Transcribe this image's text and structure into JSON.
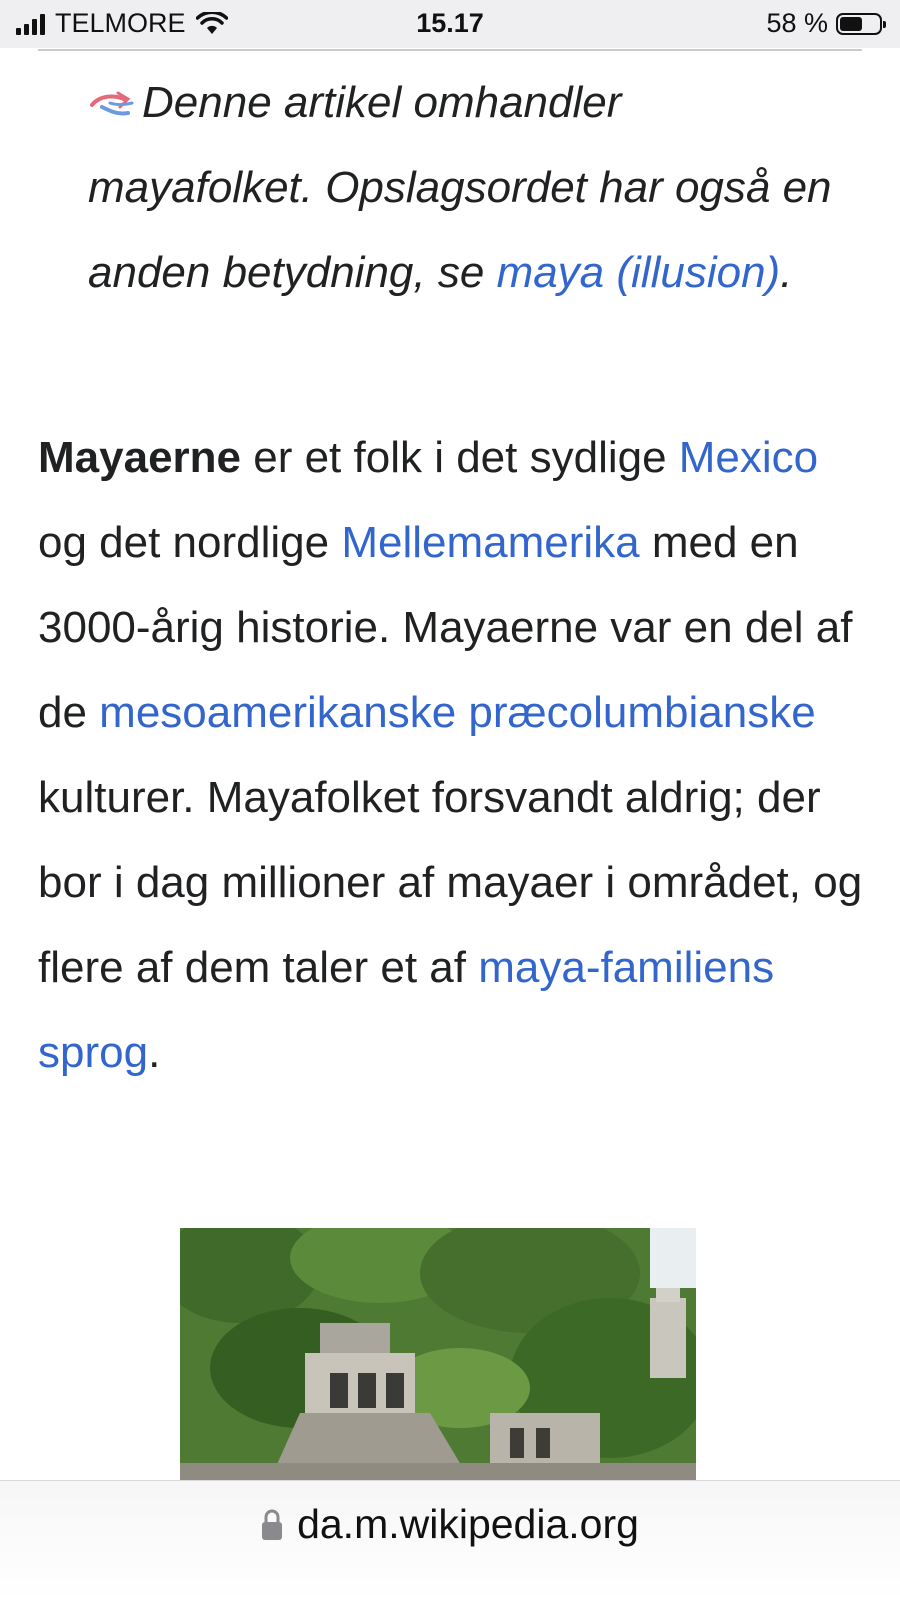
{
  "status_bar": {
    "carrier": "TELMORE",
    "time": "15.17",
    "battery_percent": "58 %",
    "battery_level": 0.58
  },
  "hatnote": {
    "text": "Denne artikel omhandler mayafolket. Opslagsordet har også en anden betydning, se",
    "link": "maya (illusion)",
    "end": "."
  },
  "article": {
    "bold": "Mayaerne",
    "t1": " er et folk i det sydlige ",
    "link_mexico": "Mexico",
    "t2": " og det nordlige ",
    "link_mellemamerika": "Mellemamerika",
    "t3": " med en 3000-årig historie. Mayaerne var en del af de ",
    "link_mesoamerikanske": "mesoamerikanske præcolumbianske",
    "t4": " kulturer. Mayafolket forsvandt aldrig; der bor i dag millioner af mayaer i området, og flere af dem taler et af ",
    "link_sprog": "maya-familiens sprog",
    "t5": "."
  },
  "url_bar": {
    "url": "da.m.wikipedia.org"
  }
}
